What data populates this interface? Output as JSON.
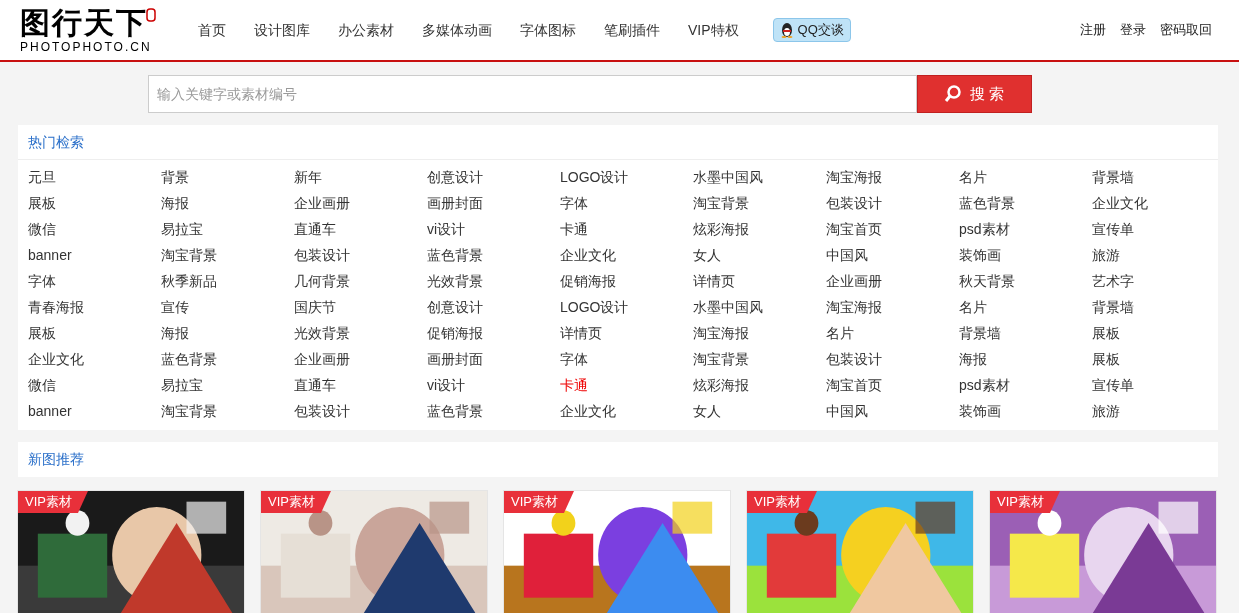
{
  "logo": {
    "title": "图行天下",
    "subtitle": "PHOTOPHOTO.CN"
  },
  "nav": [
    {
      "label": "首页",
      "selected": false
    },
    {
      "label": "设计图库",
      "selected": false
    },
    {
      "label": "办公素材",
      "selected": false
    },
    {
      "label": "多媒体动画",
      "selected": false
    },
    {
      "label": "字体图标",
      "selected": false
    },
    {
      "label": "笔刷插件",
      "selected": false
    },
    {
      "label": "VIP特权",
      "selected": false
    }
  ],
  "qq_button": "QQ交谈",
  "account_links": [
    "注册",
    "登录",
    "密码取回"
  ],
  "search": {
    "placeholder": "输入关键字或素材编号",
    "button": "搜 索"
  },
  "hot_search": {
    "title": "热门检索",
    "rows": [
      [
        {
          "label": "元旦",
          "selected": false
        },
        {
          "label": "背景",
          "selected": false
        },
        {
          "label": "新年",
          "selected": false
        },
        {
          "label": "创意设计",
          "selected": false
        },
        {
          "label": "LOGO设计",
          "selected": false
        },
        {
          "label": "水墨中国风",
          "selected": false
        },
        {
          "label": "淘宝海报",
          "selected": false
        },
        {
          "label": "名片",
          "selected": false
        },
        {
          "label": "背景墙",
          "selected": false
        }
      ],
      [
        {
          "label": "展板",
          "selected": false
        },
        {
          "label": "海报",
          "selected": false
        },
        {
          "label": "企业画册",
          "selected": false
        },
        {
          "label": "画册封面",
          "selected": false
        },
        {
          "label": "字体",
          "selected": false
        },
        {
          "label": "淘宝背景",
          "selected": false
        },
        {
          "label": "包装设计",
          "selected": false
        },
        {
          "label": "蓝色背景",
          "selected": false
        },
        {
          "label": "企业文化",
          "selected": false
        }
      ],
      [
        {
          "label": "微信",
          "selected": false
        },
        {
          "label": "易拉宝",
          "selected": false
        },
        {
          "label": "直通车",
          "selected": false
        },
        {
          "label": "vi设计",
          "selected": false
        },
        {
          "label": "卡通",
          "selected": false
        },
        {
          "label": "炫彩海报",
          "selected": false
        },
        {
          "label": "淘宝首页",
          "selected": false
        },
        {
          "label": "psd素材",
          "selected": false
        },
        {
          "label": "宣传单",
          "selected": false
        }
      ],
      [
        {
          "label": "banner",
          "selected": false
        },
        {
          "label": "淘宝背景",
          "selected": false
        },
        {
          "label": "包装设计",
          "selected": false
        },
        {
          "label": "蓝色背景",
          "selected": false
        },
        {
          "label": "企业文化",
          "selected": false
        },
        {
          "label": "女人",
          "selected": false
        },
        {
          "label": "中国风",
          "selected": false
        },
        {
          "label": "装饰画",
          "selected": false
        },
        {
          "label": "旅游",
          "selected": false
        }
      ],
      [
        {
          "label": "字体",
          "selected": false
        },
        {
          "label": "秋季新品",
          "selected": false
        },
        {
          "label": "几何背景",
          "selected": false
        },
        {
          "label": "光效背景",
          "selected": false
        },
        {
          "label": "促销海报",
          "selected": false
        },
        {
          "label": "详情页",
          "selected": false
        },
        {
          "label": "企业画册",
          "selected": false
        },
        {
          "label": "秋天背景",
          "selected": false
        },
        {
          "label": "艺术字",
          "selected": false
        }
      ],
      [
        {
          "label": "青春海报",
          "selected": false
        },
        {
          "label": "宣传",
          "selected": false
        },
        {
          "label": "国庆节",
          "selected": false
        },
        {
          "label": "创意设计",
          "selected": false
        },
        {
          "label": "LOGO设计",
          "selected": false
        },
        {
          "label": "水墨中国风",
          "selected": false
        },
        {
          "label": "淘宝海报",
          "selected": false
        },
        {
          "label": "名片",
          "selected": false
        },
        {
          "label": "背景墙",
          "selected": false
        }
      ],
      [
        {
          "label": "展板",
          "selected": false
        },
        {
          "label": "海报",
          "selected": false
        },
        {
          "label": "光效背景",
          "selected": false
        },
        {
          "label": "促销海报",
          "selected": false
        },
        {
          "label": "详情页",
          "selected": false
        },
        {
          "label": "淘宝海报",
          "selected": false
        },
        {
          "label": "名片",
          "selected": false
        },
        {
          "label": "背景墙",
          "selected": false
        },
        {
          "label": "展板",
          "selected": false
        }
      ],
      [
        {
          "label": "企业文化",
          "selected": false
        },
        {
          "label": "蓝色背景",
          "selected": false
        },
        {
          "label": "企业画册",
          "selected": false
        },
        {
          "label": "画册封面",
          "selected": false
        },
        {
          "label": "字体",
          "selected": false
        },
        {
          "label": "淘宝背景",
          "selected": false
        },
        {
          "label": "包装设计",
          "selected": false
        },
        {
          "label": "海报",
          "selected": false
        },
        {
          "label": "展板",
          "selected": false
        }
      ],
      [
        {
          "label": "微信",
          "selected": false
        },
        {
          "label": "易拉宝",
          "selected": false
        },
        {
          "label": "直通车",
          "selected": false
        },
        {
          "label": "vi设计",
          "selected": false
        },
        {
          "label": "卡通",
          "selected": true
        },
        {
          "label": "炫彩海报",
          "selected": false
        },
        {
          "label": "淘宝首页",
          "selected": false
        },
        {
          "label": "psd素材",
          "selected": false
        },
        {
          "label": "宣传单",
          "selected": false
        }
      ],
      [
        {
          "label": "banner",
          "selected": false
        },
        {
          "label": "淘宝背景",
          "selected": false
        },
        {
          "label": "包装设计",
          "selected": false
        },
        {
          "label": "蓝色背景",
          "selected": false
        },
        {
          "label": "企业文化",
          "selected": false
        },
        {
          "label": "女人",
          "selected": false
        },
        {
          "label": "中国风",
          "selected": false
        },
        {
          "label": "装饰画",
          "selected": false
        },
        {
          "label": "旅游",
          "selected": false
        }
      ]
    ]
  },
  "new_images": {
    "title": "新图推荐",
    "items": [
      {
        "badge": "VIP素材",
        "kind": "picture"
      },
      {
        "badge": "VIP素材",
        "kind": "picture"
      },
      {
        "badge": "VIP素材",
        "kind": "picture"
      },
      {
        "badge": "VIP素材",
        "kind": "picture"
      },
      {
        "badge": "VIP素材",
        "kind": "picture"
      }
    ]
  }
}
